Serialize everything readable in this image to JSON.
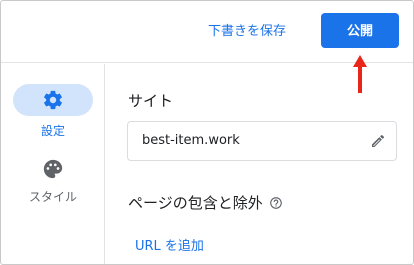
{
  "header": {
    "save_draft_label": "下書きを保存",
    "publish_label": "公開"
  },
  "sidebar": {
    "items": [
      {
        "label": "設定",
        "icon": "gear-icon",
        "active": true
      },
      {
        "label": "スタイル",
        "icon": "palette-icon",
        "active": false
      }
    ]
  },
  "main": {
    "site_title": "サイト",
    "site_url": "best-item.work",
    "pages_title": "ページの包含と除外",
    "add_url_label": "URL を追加"
  },
  "colors": {
    "accent": "#1a73e8",
    "active_pill": "#d2e3fc",
    "annotation_arrow": "#e8261a"
  }
}
